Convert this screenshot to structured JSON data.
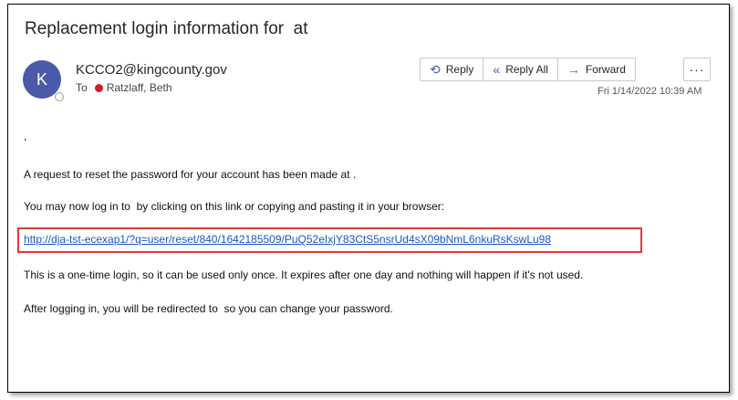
{
  "email": {
    "subject": "Replacement login information for  at",
    "avatar_initial": "K",
    "sender": "KCCO2@kingcounty.gov",
    "to_label": "To",
    "recipient": "Ratzlaff, Beth",
    "date": "Fri 1/14/2022 10:39 AM",
    "actions": {
      "reply": "Reply",
      "reply_all": "Reply All",
      "forward": "Forward",
      "more": "···"
    },
    "body": {
      "greeting": ",",
      "line1": "A request to reset the password for your account has been made at .",
      "line2": "You may now log in to  by clicking on this link or copying and pasting it in your browser:",
      "link": "http://dja-tst-ecexap1/?q=user/reset/840/1642185509/PuQ52eIxjY83CtS5nsrUd4sX09bNmL6nkuRsKswLu98",
      "line3": "This is a one-time login, so it can be used only once. It expires after one day and nothing will happen if it's not used.",
      "line4": "After logging in, you will be redirected to  so you can change your password."
    }
  },
  "colors": {
    "accent": "#4a5aa8",
    "link": "#1a56c8",
    "highlight_border": "#e53935",
    "presence_red": "#d11f2a"
  }
}
